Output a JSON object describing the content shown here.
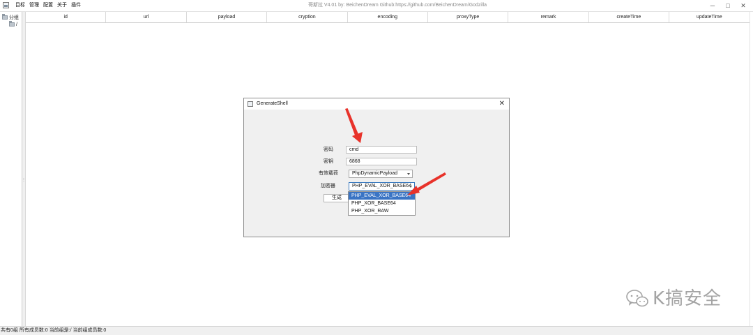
{
  "window": {
    "title": "哥斯拉    V4.01 by: BeichenDream Github:https://github.com/BeichenDream/Godzilla",
    "minimize_glyph": "─",
    "maximize_glyph": "□",
    "close_glyph": "✕"
  },
  "menu": [
    "目标",
    "管理",
    "配置",
    "关于",
    "插件"
  ],
  "tree": {
    "root_label": "分组",
    "child_label": "/"
  },
  "table": {
    "columns": [
      "id",
      "url",
      "payload",
      "cryption",
      "encoding",
      "proxyType",
      "remark",
      "createTime",
      "updateTime"
    ]
  },
  "status": {
    "text": "共有0组 所有成员数:0 当前组是:/ 当前组成员数:0"
  },
  "dialog": {
    "title": "GenerateShell",
    "close_glyph": "✕",
    "password_label": "密码",
    "password_value": "cmd",
    "key_label": "密钥",
    "key_value": "6868",
    "payload_label": "有效载荷",
    "payload_value": "PhpDynamicPayload",
    "cryption_label": "加密器",
    "cryption_value": "PHP_EVAL_XOR_BASE64",
    "generate_label": "生成",
    "cryption_options": [
      "PHP_EVAL_XOR_BASE64",
      "PHP_XOR_BASE64",
      "PHP_XOR_RAW"
    ],
    "selected_option": "PHP_EVAL_XOR_BASE64"
  },
  "watermark": {
    "text": "K搞安全"
  },
  "colors": {
    "arrow": "#e8322a",
    "selection": "#3a74c4",
    "dialog_bg": "#f0f0f0"
  }
}
